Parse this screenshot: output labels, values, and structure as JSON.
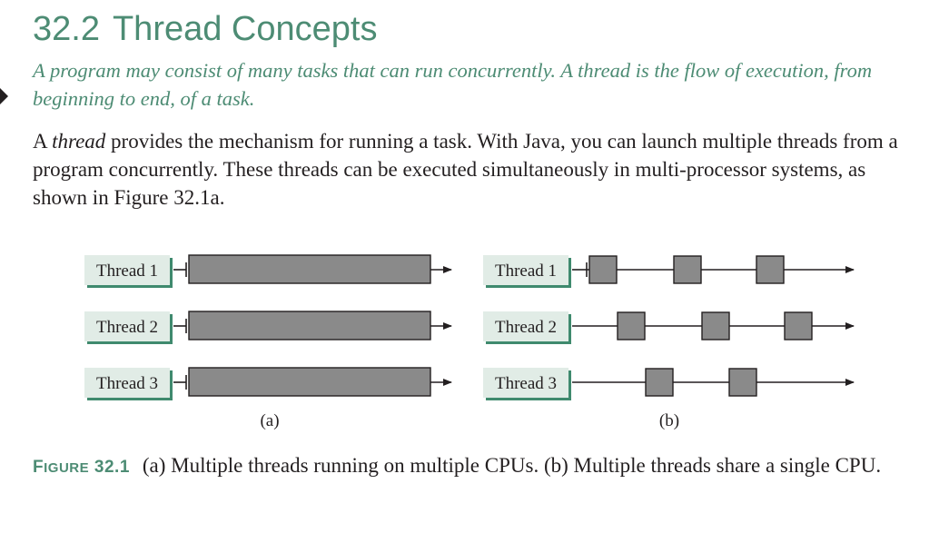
{
  "section": {
    "number": "32.2",
    "title": "Thread Concepts"
  },
  "key_point": "A program may consist of many tasks that can run concurrently. A thread is the flow of execution, from beginning to end, of a task.",
  "body": {
    "intro": "A",
    "term": "thread",
    "rest": "provides the mechanism for running a task. With Java, you can launch multiple threads from a program concurrently. These threads can be executed simultaneously in multi-processor systems, as shown in Figure 32.1a."
  },
  "figure": {
    "panel_a": {
      "label": "(a)",
      "threads": [
        "Thread 1",
        "Thread 2",
        "Thread 3"
      ]
    },
    "panel_b": {
      "label": "(b)",
      "threads": [
        "Thread 1",
        "Thread 2",
        "Thread 3"
      ]
    },
    "colors": {
      "label_fill": "#e1ece6",
      "label_shadow": "#3f8a6e",
      "bar_fill": "#8a8a8a",
      "line": "#231f20"
    }
  },
  "caption": {
    "label_prefix": "F",
    "label_smallcaps": "IGURE",
    "label_number": "32.1",
    "text": "(a) Multiple threads running on multiple CPUs. (b) Multiple threads share a single CPU."
  }
}
